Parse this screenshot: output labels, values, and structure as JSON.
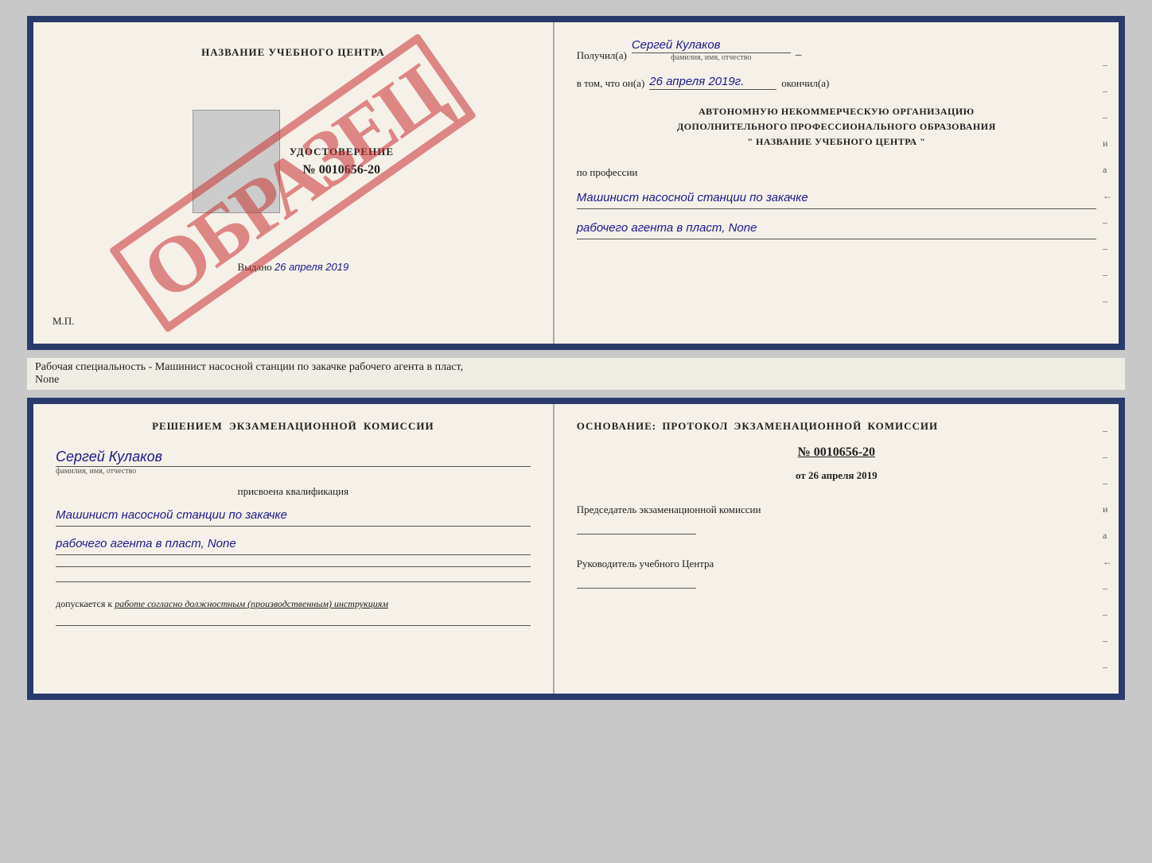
{
  "topDoc": {
    "left": {
      "centerTitle": "НАЗВАНИЕ УЧЕБНОГО ЦЕНТРА",
      "udostoverenie": "УДОСТОВЕРЕНИЕ",
      "number": "№ 0010656-20",
      "vydano": "Выдано",
      "vydanoDate": "26 апреля 2019",
      "mp": "М.П.",
      "watermark": "ОБРАЗЕЦ"
    },
    "right": {
      "poluchilLabel": "Получил(а)",
      "poluchilValue": "Сергей Кулаков",
      "familiaHint": "фамилия, имя, отчество",
      "dash1": "–",
      "vTomChtoLabel": "в том, что он(а)",
      "vTomChtoValue": "26 апреля 2019г.",
      "okончilLabel": "окончил(а)",
      "orgLine1": "АВТОНОМНУЮ НЕКОММЕРЧЕСКУЮ ОРГАНИЗАЦИЮ",
      "orgLine2": "ДОПОЛНИТЕЛЬНОГО ПРОФЕССИОНАЛЬНОГО ОБРАЗОВАНИЯ",
      "orgLine3": "\"   НАЗВАНИЕ УЧЕБНОГО ЦЕНТРА   \"",
      "professionLabel": "по профессии",
      "professionLine1": "Машинист насосной станции по закачке",
      "professionLine2": "рабочего агента в пласт, None",
      "sideDashes": [
        "-",
        "-",
        "-",
        "и",
        "а",
        "←",
        "-",
        "-",
        "-",
        "-"
      ]
    }
  },
  "caption": "Рабочая специальность - Машинист насосной станции по закачке рабочего агента в пласт,",
  "captionLine2": "None",
  "bottomDoc": {
    "left": {
      "kommissiyaTitle": "Решением экзаменационной комиссии",
      "personName": "Сергей Кулаков",
      "familiaHint": "фамилия, имя, отчество",
      "prisvoenaLabel": "присвоена квалификация",
      "qualLine1": "Машинист насосной станции по закачке",
      "qualLine2": "рабочего агента в пласт, None",
      "dopuskaetsyaLabel": "допускается к",
      "dopuskaetsyaValue": "работе согласно должностным (производственным) инструкциям"
    },
    "right": {
      "osnovTitle": "Основание: протокол экзаменационной комиссии",
      "protocolNumber": "№ 0010656-20",
      "otLabel": "от",
      "otDate": "26 апреля 2019",
      "predsedatelLabel": "Председатель экзаменационной комиссии",
      "rukovoditelLabel": "Руководитель учебного Центра",
      "sideDashes": [
        "-",
        "-",
        "-",
        "и",
        "а",
        "←",
        "-",
        "-",
        "-",
        "-"
      ]
    }
  }
}
